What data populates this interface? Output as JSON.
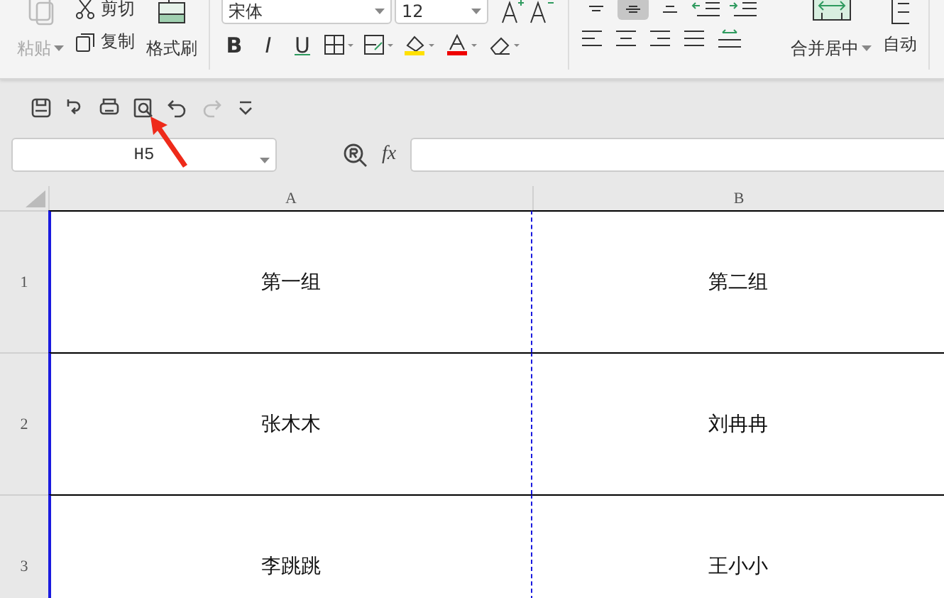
{
  "ribbon": {
    "clipboard": {
      "paste": "粘贴",
      "cut": "剪切",
      "copy": "复制",
      "format_painter": "格式刷"
    },
    "font": {
      "name": "宋体",
      "size": "12",
      "bold": "B",
      "italic": "I",
      "underline": "U"
    },
    "vertical_align": [
      {
        "kind": "top",
        "selected": false
      },
      {
        "kind": "middle",
        "selected": true
      },
      {
        "kind": "bottom",
        "selected": false
      }
    ],
    "merge": "合并居中",
    "wrap": "自动"
  },
  "quick_access": [
    {
      "kind": "save",
      "disabled": false
    },
    {
      "kind": "export",
      "disabled": false
    },
    {
      "kind": "print",
      "disabled": false
    },
    {
      "kind": "preview",
      "disabled": false
    },
    {
      "kind": "undo",
      "disabled": false
    },
    {
      "kind": "redo",
      "disabled": true
    },
    {
      "kind": "more",
      "disabled": false
    }
  ],
  "formula_bar": {
    "name_box": "H5",
    "fx": "fx"
  },
  "sheet": {
    "columns": [
      "A",
      "B"
    ],
    "rows": [
      {
        "header": "1",
        "cells": [
          "第一组",
          "第二组"
        ]
      },
      {
        "header": "2",
        "cells": [
          "张木木",
          "刘冉冉"
        ]
      },
      {
        "header": "3",
        "cells": [
          "李跳跳",
          "王小小"
        ]
      }
    ]
  }
}
